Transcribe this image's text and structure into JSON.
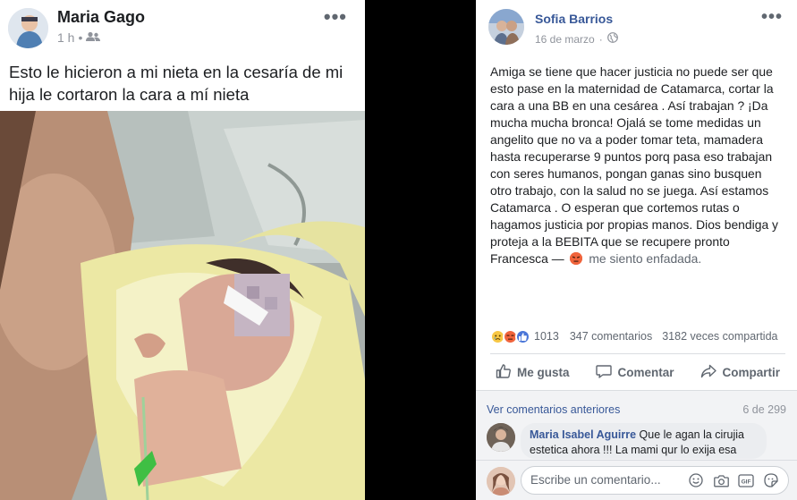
{
  "left_post": {
    "author": "Maria Gago",
    "time": "1 h",
    "privacy_icon": "friends-icon",
    "more": "•••",
    "text": "Esto le hicieron a mi nieta en la cesaría de mi hija le cortaron la cara a mí nieta"
  },
  "right_post": {
    "author": "Sofia Barrios",
    "date": "16 de marzo",
    "privacy_icon": "globe-icon",
    "more": "•••",
    "text": "Amiga se tiene que hacer justicia no puede ser que esto pase en la maternidad de Catamarca, cortar la cara a una BB en una cesárea . Así trabajan ? ¡Da mucha mucha bronca! Ojalá se tome medidas un angelito que no va a poder tomar teta, mamadera hasta recuperarse 9 puntos porq pasa eso trabajan con seres humanos, pongan ganas sino busquen otro trabajo, con la salud no se juega. Así estamos Catamarca . O esperan que cortemos rutas o hagamos justicia por propias manos. Dios bendiga y proteja a la BEBITA que se recupere pronto Francesca —",
    "feeling": "me siento enfadada.",
    "reactions": {
      "icons": [
        "sad-icon",
        "angry-icon",
        "like-icon"
      ],
      "count": "1013",
      "comments": "347 comentarios",
      "shares": "3182 veces compartida"
    },
    "actions": {
      "like": "Me gusta",
      "comment": "Comentar",
      "share": "Compartir"
    },
    "comments_section": {
      "view_previous": "Ver comentarios anteriores",
      "pager": "6 de 299",
      "comment": {
        "author": "Maria Isabel Aguirre",
        "text": "Que le agan la cirujia estetica ahora !!! La mami qur lo exija esa"
      },
      "compose_placeholder": "Escribe un comentario..."
    }
  },
  "colors": {
    "link": "#385898",
    "muted": "#90949c",
    "angry": "#f0643c",
    "like": "#4a76d8",
    "sad": "#f7c744"
  }
}
